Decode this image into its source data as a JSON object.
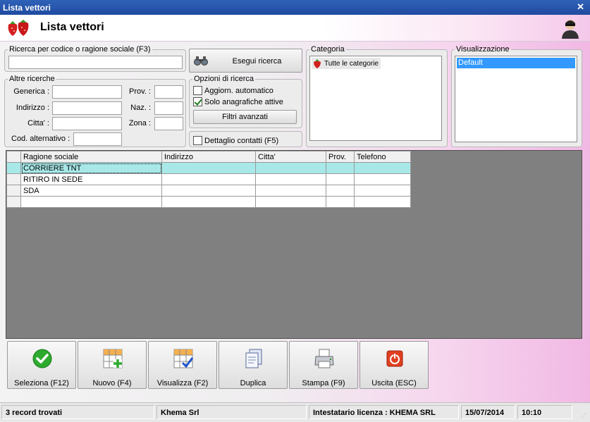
{
  "window": {
    "title": "Lista vettori"
  },
  "header": {
    "title": "Lista vettori"
  },
  "search": {
    "legend": "Ricerca per codice o ragione sociale (F3)",
    "value": "",
    "button_label": "Esegui ricerca"
  },
  "other": {
    "legend": "Altre ricerche",
    "generica": "Generica :",
    "indirizzo": "Indirizzo :",
    "citta": "Citta' :",
    "cod_alt": "Cod. alternativo :",
    "prov": "Prov. :",
    "naz": "Naz. :",
    "zona": "Zona :"
  },
  "options": {
    "legend": "Opzioni di ricerca",
    "auto_update": {
      "label": "Aggiorn. automatico",
      "checked": false
    },
    "active_only": {
      "label": "Solo anagrafiche attive",
      "checked": true
    },
    "advanced_button": "Filtri avanzati",
    "contact_detail": {
      "label": "Dettaglio contatti (F5)",
      "checked": false
    }
  },
  "category": {
    "legend": "Categoria",
    "items": [
      "Tutte le categorie"
    ]
  },
  "view": {
    "legend": "Visualizzazione",
    "items": [
      "Default"
    ],
    "selected": "Default"
  },
  "grid": {
    "columns": [
      "Ragione sociale",
      "Indirizzo",
      "Citta'",
      "Prov.",
      "Telefono"
    ],
    "rows": [
      [
        "CORRIERE TNT",
        "",
        "",
        "",
        ""
      ],
      [
        "RITIRO IN SEDE",
        "",
        "",
        "",
        ""
      ],
      [
        "SDA",
        "",
        "",
        "",
        ""
      ],
      [
        "",
        "",
        "",
        "",
        ""
      ]
    ],
    "selected_row": 0
  },
  "toolbar": {
    "select": "Seleziona (F12)",
    "new": "Nuovo (F4)",
    "view": "Visualizza (F2)",
    "duplicate": "Duplica",
    "print": "Stampa (F9)",
    "exit": "Uscita (ESC)"
  },
  "status": {
    "records": "3 record trovati",
    "company": "Khema Srl",
    "license": "Intestatario licenza : KHEMA SRL",
    "date": "15/07/2014",
    "time": "10:10"
  },
  "colors": {
    "title_bar": "#2f62b8",
    "accent_pink": "#f1b8e4",
    "selection": "#a8e8e8",
    "list_selection": "#3399ff"
  }
}
